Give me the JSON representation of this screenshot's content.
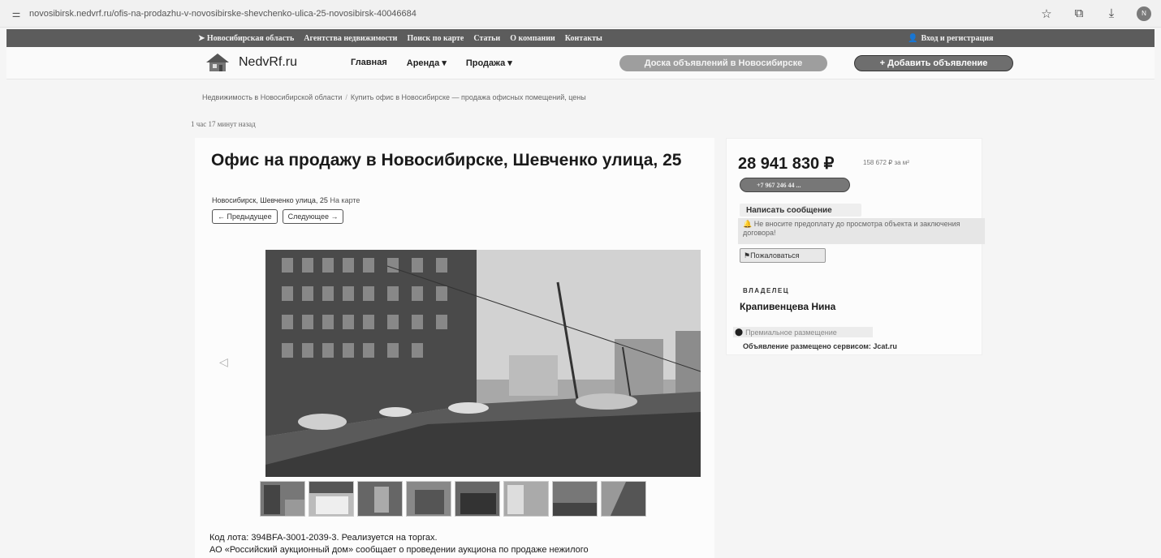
{
  "browser": {
    "url": "novosibirsk.nedvrf.ru/ofis-na-prodazhu-v-novosibirske-shevchenko-ulica-25-novosibirsk-40046684",
    "profile_initial": "N"
  },
  "top_nav": {
    "links": [
      "Новосибирская область",
      "Агентства недвижимости",
      "Поиск по карте",
      "Статьи",
      "О компании",
      "Контакты"
    ],
    "login": "Вход и регистрация"
  },
  "header": {
    "logo_text": "NedvRf.ru",
    "nav": [
      "Главная",
      "Аренда ▾",
      "Продажа ▾"
    ],
    "board_button": "Доска объявлений в Новосибирске",
    "add_button": "+ Добавить объявление"
  },
  "breadcrumb": {
    "item1": "Недвижимость в Новосибирской области",
    "separator": "/",
    "item2": "Купить офис в Новосибирске — продажа офисных помещений, цены"
  },
  "time_ago": "1 час 17 минут назад",
  "listing": {
    "title": "Офис на продажу в Новосибирске, Шевченко улица, 25",
    "address": "Новосибирск, Шевченко улица, 25",
    "map_link": "На карте",
    "prev_button": "← Предыдущее",
    "next_button": "Следующее →",
    "lot_text": "Код лота: 394BFA-3001-2039-3. Реализуется на торгах.",
    "desc_text": "АО «Российский аукционный дом» сообщает о проведении аукциона по продаже нежилого"
  },
  "sidebar": {
    "price": "28 941 830 ₽",
    "price_per_m": "158 672 ₽ за м²",
    "phone": "+7 967 246 44 ...",
    "message_button": "Написать сообщение",
    "warning": "Не вносите предоплату до просмотра объекта и заключения договора!",
    "complain_button": "Пожаловаться",
    "owner_label": "ВЛАДЕЛЕЦ",
    "owner_name": "Крапивенцева Нина",
    "premium": "Премиальное размещение",
    "service": "Объявление размещено сервисом: Jcat.ru"
  }
}
